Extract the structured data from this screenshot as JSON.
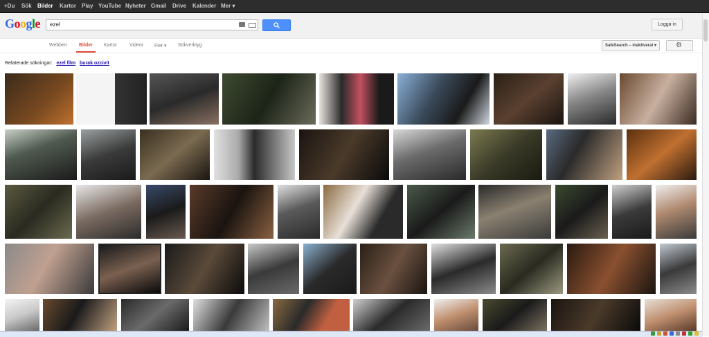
{
  "topbar": {
    "items": [
      "+Du",
      "Sök",
      "Bilder",
      "Kartor",
      "Play",
      "YouTube",
      "Nyheter",
      "Gmail",
      "Drive",
      "Kalender",
      "Mer ▾"
    ],
    "active_index": 2
  },
  "header": {
    "logo_letters": [
      "G",
      "o",
      "o",
      "g",
      "l",
      "e"
    ],
    "logo_colors": [
      "#3369e8",
      "#d50f25",
      "#eeb211",
      "#3369e8",
      "#009925",
      "#d50f25"
    ],
    "search_value": "ezel",
    "login_label": "Logga in",
    "search_button_color": "#4d90fe"
  },
  "nav": {
    "tabs": [
      "Webben",
      "Bilder",
      "Kartor",
      "Videor",
      "Fler ▾",
      "Sökverktyg"
    ],
    "active_index": 1,
    "safesearch_label": "SafeSearch – inaktiverat ▾"
  },
  "related": {
    "label": "Relaterade sökningar:",
    "links": [
      "ezel film",
      "burak ozcivit"
    ]
  },
  "image_grid": {
    "rows": 5,
    "counts_per_row": [
      9,
      9,
      11,
      10,
      11
    ]
  }
}
